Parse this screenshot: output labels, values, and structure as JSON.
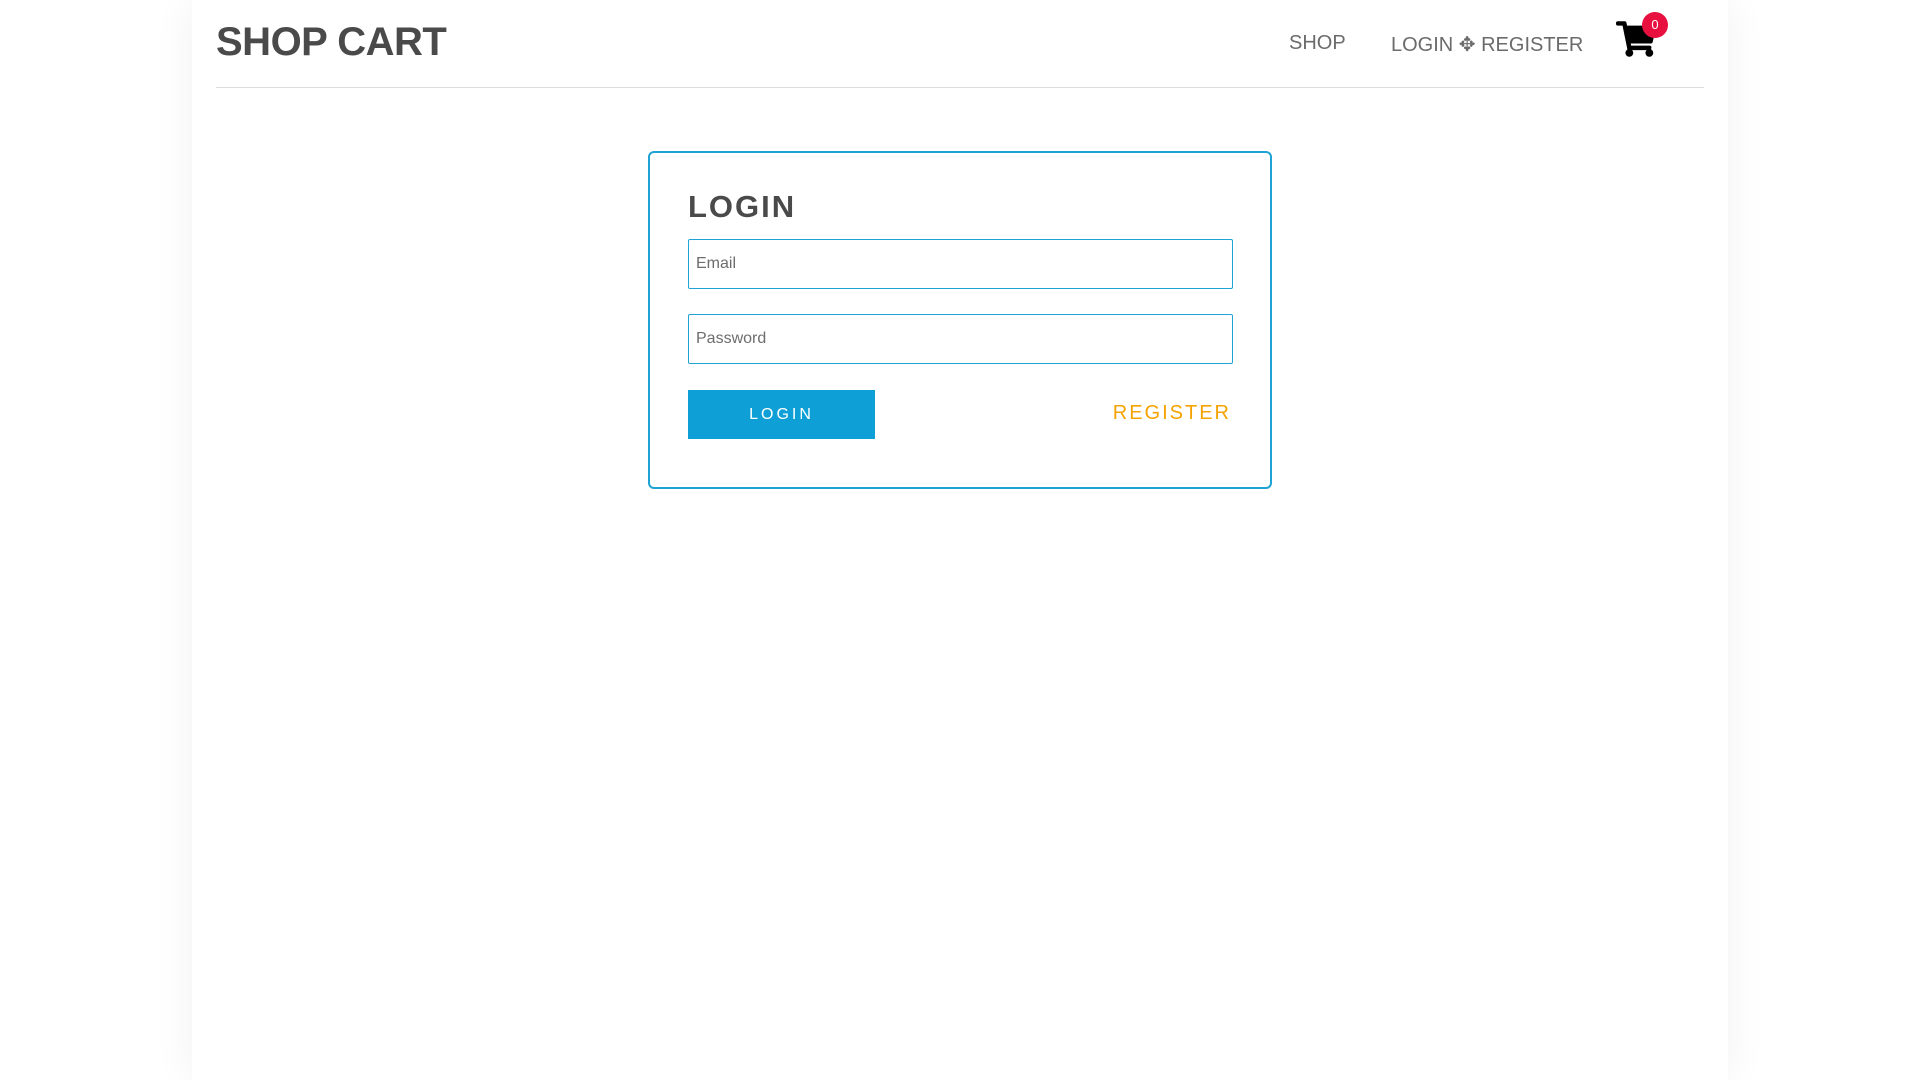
{
  "header": {
    "brand": "SHOP CART",
    "nav": {
      "shop": "SHOP",
      "auth": "LOGIN ✥ REGISTER"
    },
    "cart": {
      "icon": "shopping-cart-icon",
      "count": "0"
    }
  },
  "login": {
    "title": "LOGIN",
    "email": {
      "placeholder": "Email",
      "value": ""
    },
    "password": {
      "placeholder": "Password",
      "value": ""
    },
    "submit_label": "LOGIN",
    "register_label": "REGISTER"
  },
  "colors": {
    "accent": "#0e9fd6",
    "card_border": "#1ea3d4",
    "register_link": "#f5a300",
    "badge": "#e8103f",
    "text_dark": "#4a4a4a"
  }
}
